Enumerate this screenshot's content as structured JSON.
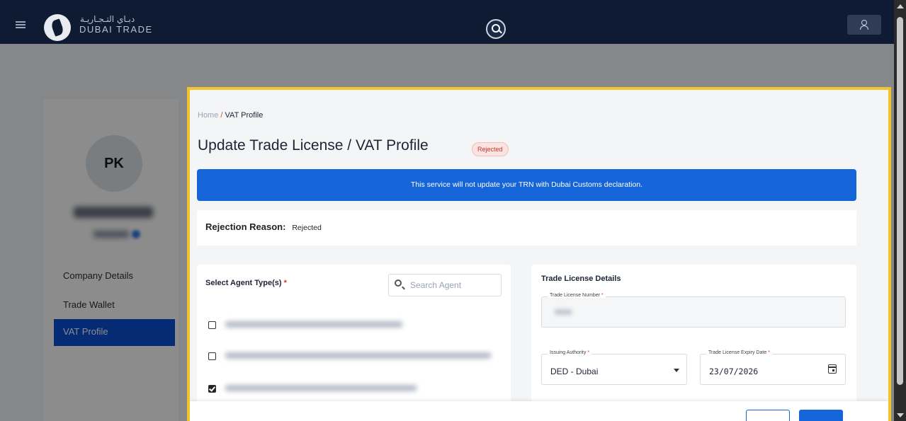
{
  "topbar": {
    "logo_arabic": "دبـاي التـجـاريـة",
    "logo_text": "DUBAI TRADE"
  },
  "profile": {
    "initials": "PK"
  },
  "sidebar": {
    "items": [
      {
        "label": "Company Details",
        "active": false
      },
      {
        "label": "Trade Wallet",
        "active": false
      },
      {
        "label": "VAT Profile",
        "active": true
      }
    ]
  },
  "breadcrumb": {
    "home": "Home",
    "separator": "/",
    "current": "VAT Profile"
  },
  "page": {
    "title": "Update Trade License / VAT Profile",
    "status_badge": "Rejected"
  },
  "banner": {
    "text": "This service will not update your TRN with Dubai Customs declaration."
  },
  "rejection": {
    "label": "Rejection Reason:",
    "value": "Rejected"
  },
  "agent_types": {
    "title": "Select Agent Type(s)",
    "required_mark": "*",
    "search_placeholder": "Search Agent",
    "items": [
      {
        "checked": false
      },
      {
        "checked": false
      },
      {
        "checked": true
      }
    ]
  },
  "trade_license": {
    "title": "Trade License Details",
    "license_number_label": "Trade License Number",
    "issuing_authority_label": "Issuing Authority",
    "issuing_authority_value": "DED - Dubai",
    "expiry_label": "Trade License Expiry Date",
    "expiry_value": "23/07/2026",
    "required_mark": "*"
  },
  "colors": {
    "accent": "#1565d8",
    "highlight_border": "#f2c32a",
    "nav_bg": "#0f1b33",
    "rejected": "#c0392b"
  }
}
